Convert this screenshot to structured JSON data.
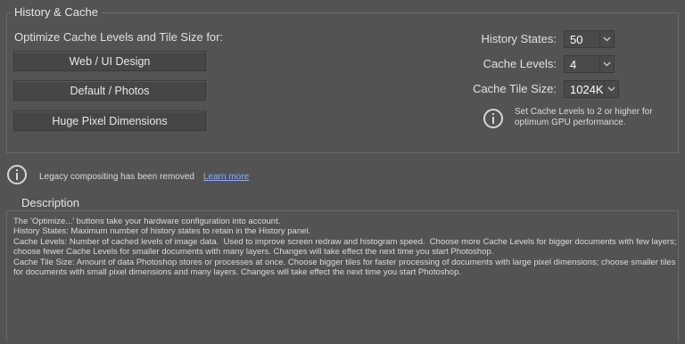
{
  "history_cache": {
    "title": "History & Cache",
    "optimize_label": "Optimize Cache Levels and Tile Size for:",
    "buttons": {
      "web": "Web / UI Design",
      "default": "Default / Photos",
      "huge": "Huge Pixel Dimensions"
    },
    "history_states": {
      "label": "History States:",
      "value": "50"
    },
    "cache_levels": {
      "label": "Cache Levels:",
      "value": "4"
    },
    "cache_tile_size": {
      "label": "Cache Tile Size:",
      "value": "1024K"
    },
    "gpu_note": "Set Cache Levels to 2 or higher for optimum GPU performance."
  },
  "legacy": {
    "text": "Legacy compositing has been removed",
    "link": "Learn more"
  },
  "description": {
    "title": "Description",
    "lines": [
      "The 'Optimize...' buttons take your hardware configuration into account.",
      "History States: Maximum number of history states to retain in the History panel.",
      "Cache Levels: Number of cached levels of image data.  Used to improve screen redraw and histogram speed.  Choose more Cache Levels for bigger documents with few layers; choose fewer Cache Levels for smaller documents with many layers. Changes will take effect the next time you start Photoshop.",
      "Cache Tile Size: Amount of data Photoshop stores or processes at once. Choose bigger tiles for faster processing of documents with large pixel dimensions; choose smaller tiles for documents with small pixel dimensions and many layers. Changes will take effect the next time you start Photoshop."
    ]
  }
}
